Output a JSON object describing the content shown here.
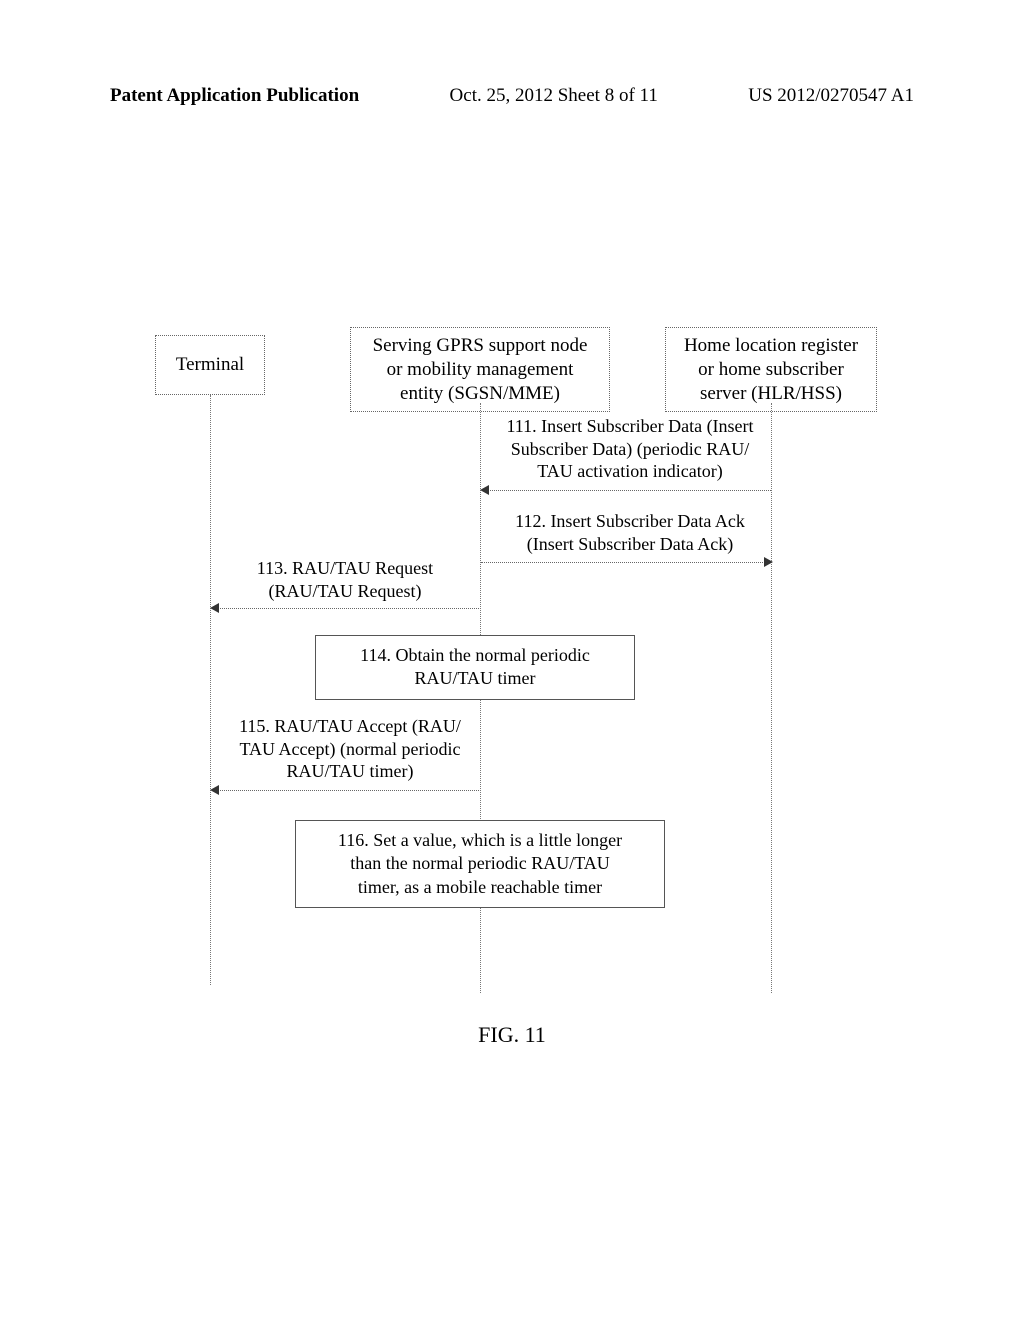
{
  "header": {
    "left": "Patent Application Publication",
    "center": "Oct. 25, 2012  Sheet 8 of 11",
    "right": "US 2012/0270547 A1"
  },
  "actors": {
    "terminal": "Terminal",
    "sgsn_line1": "Serving GPRS support node",
    "sgsn_line2": "or mobility management",
    "sgsn_line3": "entity (SGSN/MME)",
    "hlr_line1": "Home location register",
    "hlr_line2": "or home subscriber",
    "hlr_line3": "server (HLR/HSS)"
  },
  "messages": {
    "m111_l1": "111. Insert Subscriber Data (Insert",
    "m111_l2": "Subscriber Data) (periodic RAU/",
    "m111_l3": "TAU activation indicator)",
    "m112_l1": "112. Insert Subscriber Data Ack",
    "m112_l2": "(Insert Subscriber Data Ack)",
    "m113_l1": "113. RAU/TAU Request",
    "m113_l2": "(RAU/TAU Request)",
    "m114_l1": "114. Obtain the normal periodic",
    "m114_l2": "RAU/TAU timer",
    "m115_l1": "115. RAU/TAU Accept (RAU/",
    "m115_l2": "TAU Accept) (normal periodic",
    "m115_l3": "RAU/TAU timer)",
    "m116_l1": "116. Set a value, which is a little longer",
    "m116_l2": "than the normal periodic RAU/TAU",
    "m116_l3": "timer, as a mobile reachable timer"
  },
  "figure_caption": "FIG. 11"
}
